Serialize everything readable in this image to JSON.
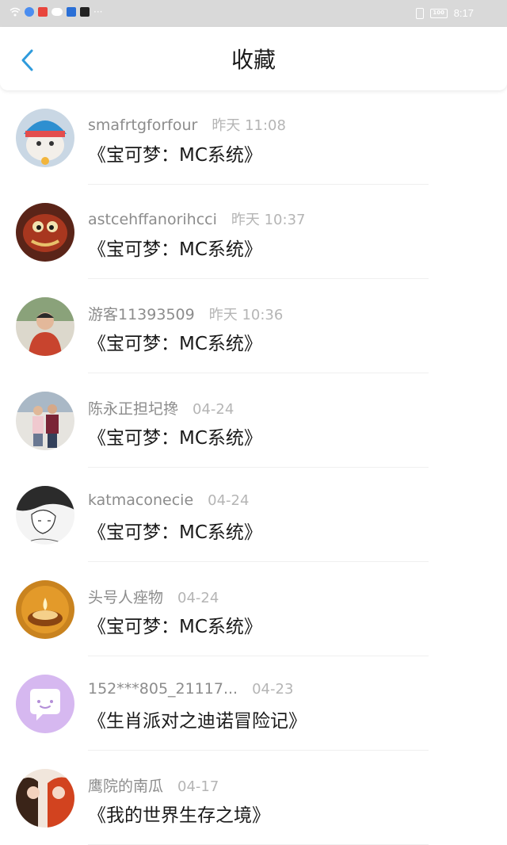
{
  "status_bar": {
    "time": "8:17",
    "battery": "100",
    "left_icons": [
      "wifi-icon",
      "app-icon",
      "app-icon",
      "cloud-icon",
      "app-icon",
      "app-icon"
    ],
    "overflow": "···"
  },
  "header": {
    "title": "收藏",
    "back_icon": "chevron-left-icon",
    "accent_color": "#2f9bdc"
  },
  "items": [
    {
      "username": "smafrtgforfour",
      "time": "昨天 11:08",
      "title": "《宝可梦：MC系统》",
      "avatar": "cat-photo"
    },
    {
      "username": "astcehffanorihcci",
      "time": "昨天 10:37",
      "title": "《宝可梦：MC系统》",
      "avatar": "cartoon-character"
    },
    {
      "username": "游客11393509",
      "time": "昨天 10:36",
      "title": "《宝可梦：MC系统》",
      "avatar": "person-photo"
    },
    {
      "username": "陈永正担圮搀",
      "time": "04-24",
      "title": "《宝可梦：MC系统》",
      "avatar": "couple-photo"
    },
    {
      "username": "katmaconecie",
      "time": "04-24",
      "title": "《宝可梦：MC系统》",
      "avatar": "sketch-drawing"
    },
    {
      "username": "头号人痤物",
      "time": "04-24",
      "title": "《宝可梦：MC系统》",
      "avatar": "candle-photo"
    },
    {
      "username": "152***805_21117...",
      "time": "04-23",
      "title": "《生肖派对之迪诺冒险记》",
      "avatar": "default-chat-avatar"
    },
    {
      "username": "鹰院的南瓜",
      "time": "04-17",
      "title": "《我的世界生存之境》",
      "avatar": "anime-characters"
    }
  ]
}
